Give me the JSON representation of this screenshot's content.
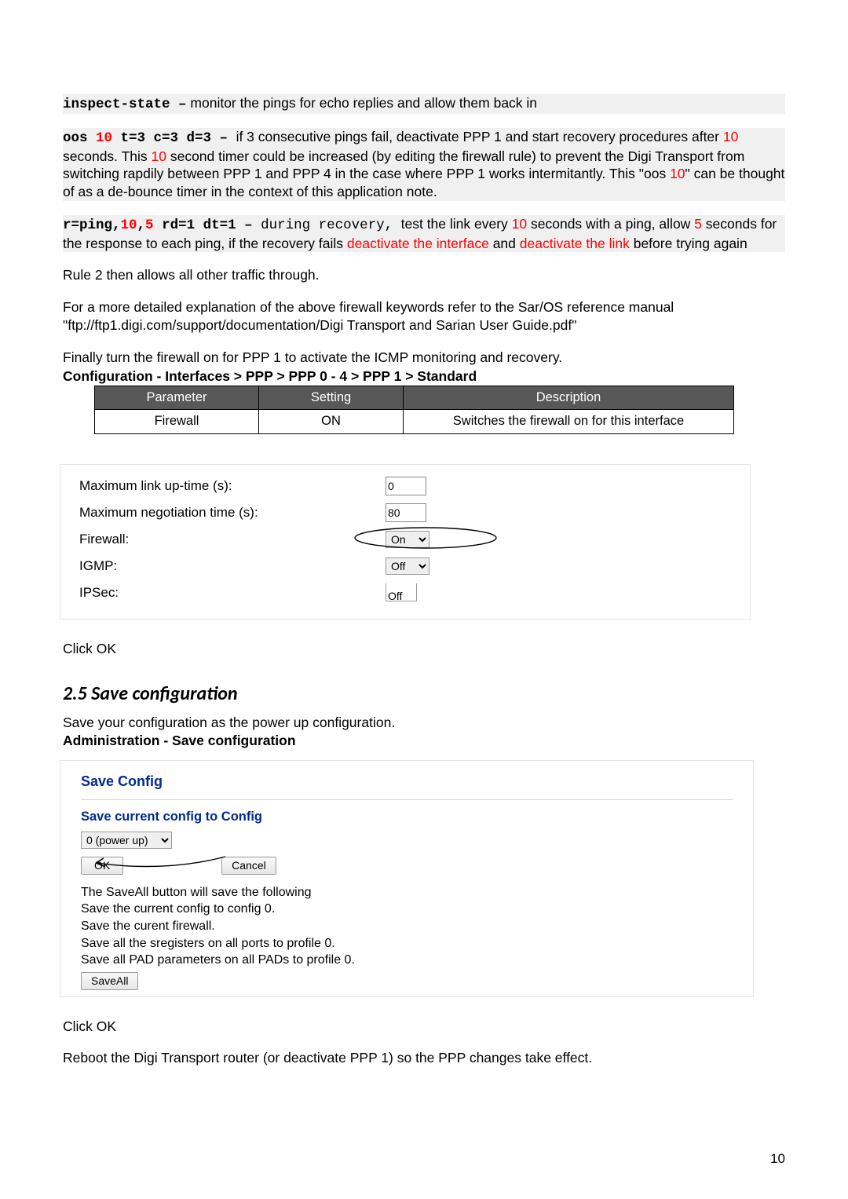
{
  "para1": {
    "code": "inspect-state –",
    "text": "  monitor the pings for echo replies and allow them back in"
  },
  "para2": {
    "seg1": "oos ",
    "r1": "10",
    "seg2": " t=3 c=3 d=3 – ",
    "after": " if 3 consecutive pings fail, deactivate PPP 1 and start recovery procedures after ",
    "r2": "10",
    "seg3": " seconds. This ",
    "r3": "10",
    "seg4": " second timer could be increased (by editing the firewall rule) to prevent the Digi Transport from switching rapdily between PPP 1 and PPP 4 in the case where PPP 1 works intermitantly. This \"oos ",
    "r4": "10",
    "seg5": "\" can be thought of as a de-bounce timer in the context of this application note."
  },
  "para3": {
    "c1": "r=ping,",
    "r1": "10",
    "c2": ",",
    "r2": "5",
    "c3": " rd=1 dt=1 – ",
    "c4": "during recovery, ",
    "t1": "test the link every ",
    "r3": "10",
    "t2": " seconds with a ping, allow ",
    "r4": "5",
    "t3": " seconds for the response to each ping, if the recovery fails ",
    "d1": "deactivate the interface",
    "t4": " and ",
    "d2": "deactivate the link",
    "t5": " before trying again"
  },
  "rule2": "Rule 2 then allows all other traffic through.",
  "detailed1": "For a more detailed explanation of the above firewall keywords refer to the Sar/OS reference manual \"ftp://ftp1.digi.com/support/documentation/Digi Transport and Sarian User Guide.pdf\"",
  "finally": "Finally turn the firewall on for PPP 1 to activate the ICMP monitoring and recovery.",
  "breadcrumb": "Configuration - Interfaces > PPP > PPP 0 - 4 > PPP 1 > Standard",
  "table": {
    "h1": "Parameter",
    "h2": "Setting",
    "h3": "Description",
    "c1": "Firewall",
    "c2": "ON",
    "c3": "Switches the firewall on for this interface"
  },
  "settings": {
    "l1": "Maximum link up-time (s):",
    "v1": "0",
    "l2": "Maximum negotiation time (s):",
    "v2": "80",
    "l3": "Firewall:",
    "v3": "On",
    "l4": "IGMP:",
    "v4": "Off",
    "l5": "IPSec:",
    "v5": "Off"
  },
  "clickok": "Click OK",
  "h25": "2.5   Save configuration",
  "saveintro": "Save your configuration as the power up configuration.",
  "adminpath": "Administration - Save configuration",
  "savebox": {
    "title": "Save Config",
    "subtitle": "Save current config to Config",
    "select": "0 (power up)",
    "ok": "OK",
    "cancel": "Cancel",
    "desc1": "The SaveAll button will save the following",
    "desc2": "Save the current config to config 0.",
    "desc3": "Save the curent firewall.",
    "desc4": "Save all the sregisters on all ports to profile 0.",
    "desc5": "Save all PAD parameters on all PADs to profile 0.",
    "saveall": "SaveAll"
  },
  "reboot": "Reboot the Digi Transport router (or deactivate PPP 1) so the PPP changes take effect.",
  "page": "10"
}
